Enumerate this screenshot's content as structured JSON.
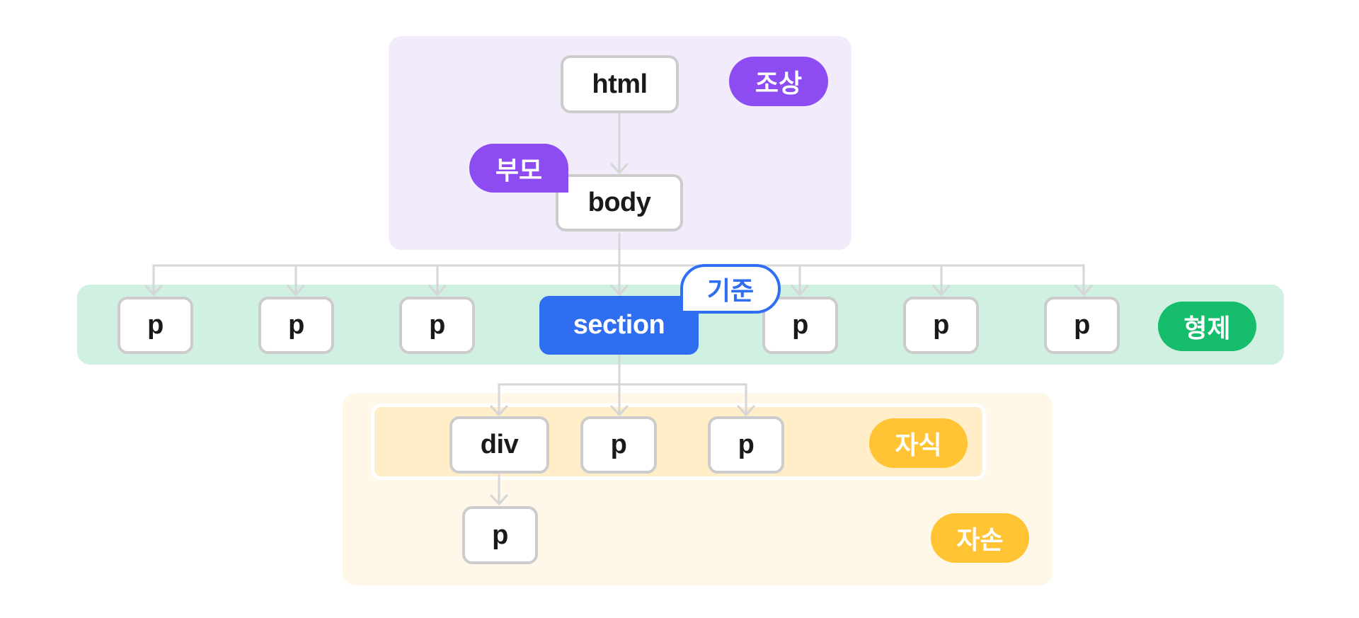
{
  "groups": {
    "ancestor": {
      "label": "조상",
      "color": "#8c4cf2",
      "bg": "#f2ebfc"
    },
    "parent": {
      "label": "부모",
      "color": "#8c4cf2"
    },
    "sibling": {
      "label": "형제",
      "color": "#16bd6c",
      "bg": "#d0f0e1"
    },
    "reference": {
      "label": "기준",
      "color": "#2f6ef0"
    },
    "child": {
      "label": "자식",
      "color": "#ffc333",
      "bg": "#ffeec8"
    },
    "descendant": {
      "label": "자손",
      "color": "#ffc333",
      "bg": "#fff8e9"
    }
  },
  "nodes": {
    "html": "html",
    "body": "body",
    "siblings_left": [
      "p",
      "p",
      "p"
    ],
    "section": "section",
    "siblings_right": [
      "p",
      "p",
      "p"
    ],
    "children": [
      "div",
      "p",
      "p"
    ],
    "grandchild": "p"
  },
  "edges": [
    [
      "html",
      "body"
    ],
    [
      "body",
      "sibling-1"
    ],
    [
      "body",
      "sibling-2"
    ],
    [
      "body",
      "sibling-3"
    ],
    [
      "body",
      "section"
    ],
    [
      "body",
      "sibling-4"
    ],
    [
      "body",
      "sibling-5"
    ],
    [
      "body",
      "sibling-6"
    ],
    [
      "section",
      "div"
    ],
    [
      "section",
      "child-p-1"
    ],
    [
      "section",
      "child-p-2"
    ],
    [
      "div",
      "grandchild-p"
    ]
  ]
}
